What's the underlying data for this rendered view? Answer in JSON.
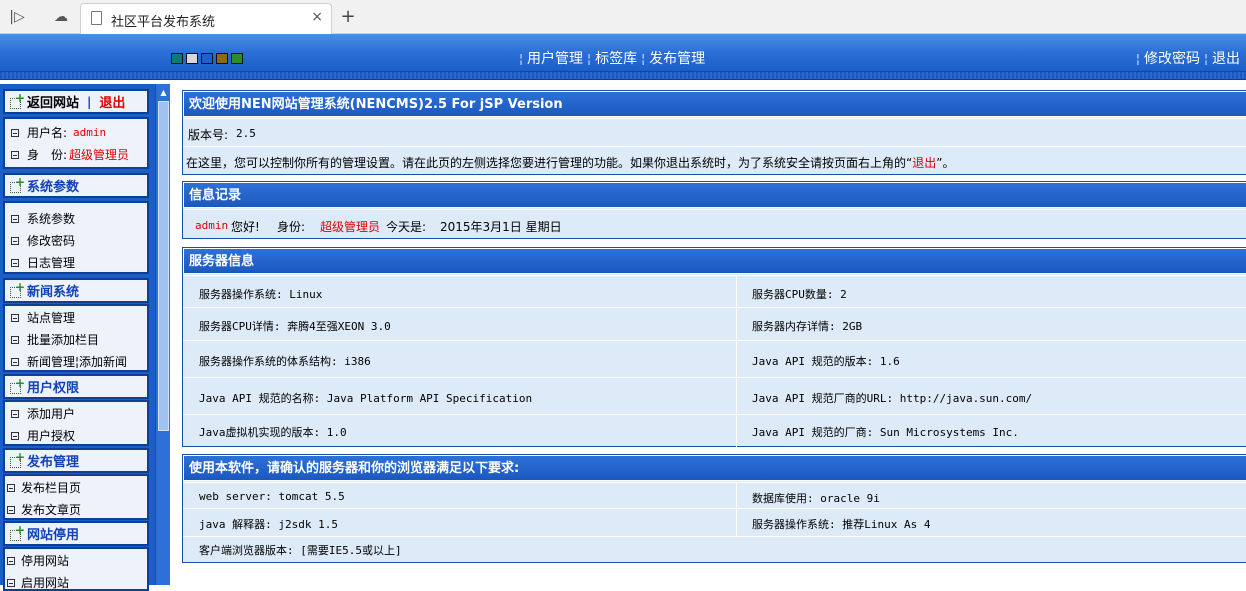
{
  "browser": {
    "tab_title": "社区平台发布系统",
    "tab_close": "×",
    "new_tab": "+",
    "back_icon": "|▷",
    "cloud_icon": "☁"
  },
  "topbar": {
    "swatch_colors": [
      "#0a7a7a",
      "#d8d8d8",
      "#1f5fd2",
      "#8c6a14",
      "#2a8f2a"
    ],
    "nav": [
      "用户管理",
      "标签库",
      "发布管理"
    ],
    "links": [
      "修改密码",
      "退出"
    ],
    "sep": "¦"
  },
  "sidebar": {
    "header": {
      "back": "返回网站",
      "divider": "|",
      "logout": "退出"
    },
    "user": {
      "username_label": "用户名:",
      "username": "admin",
      "role_label": "身　份:",
      "role": "超级管理员"
    },
    "sections": [
      {
        "title": "系统参数",
        "items": [
          "系统参数",
          "修改密码",
          "日志管理"
        ]
      },
      {
        "title": "新闻系统",
        "items": [
          "站点管理",
          "批量添加栏目",
          "新闻管理¦添加新闻"
        ]
      },
      {
        "title": "用户权限",
        "items": [
          "添加用户",
          "用户授权"
        ]
      },
      {
        "title": "发布管理",
        "items": [
          "发布栏目页",
          "发布文章页"
        ]
      },
      {
        "title": "网站停用",
        "items": [
          "停用网站",
          "启用网站"
        ]
      }
    ]
  },
  "welcome": {
    "title": "欢迎使用NEN网站管理系统(NENCMS)2.5 For jSP Version",
    "version_label": "版本号:",
    "version": "2.5",
    "desc_before": "在这里，您可以控制你所有的管理设置。请在此页的左侧选择您要进行管理的功能。如果你退出系统时，为了系统安全请按页面右上角的“",
    "desc_link": "退出",
    "desc_after": "”。"
  },
  "info": {
    "title": "信息记录",
    "user": "admin",
    "greet": "您好!",
    "role_label": "身份:",
    "role": "超级管理员",
    "today_label": "今天是:",
    "date": "2015年3月1日 星期日"
  },
  "server": {
    "title": "服务器信息",
    "rows": [
      [
        "服务器操作系统: Linux",
        "服务器CPU数量: 2"
      ],
      [
        "服务器CPU详情: 奔腾4至强XEON 3.0",
        "服务器内存详情: 2GB"
      ],
      [
        "服务器操作系统的体系结构:  i386",
        "Java API 规范的版本: 1.6"
      ],
      [
        "Java API 规范的名称: Java Platform API Specification",
        "Java API 规范厂商的URL: http://java.sun.com/"
      ],
      [
        "Java虚拟机实现的版本: 1.0",
        "Java API 规范的厂商: Sun Microsystems Inc."
      ]
    ]
  },
  "requirements": {
    "title": "使用本软件，请确认的服务器和你的浏览器满足以下要求:",
    "rows": [
      [
        "web server:  tomcat 5.5",
        "数据库使用:  oracle 9i"
      ],
      [
        "java 解释器: j2sdk 1.5",
        "服务器操作系统: 推荐Linux As 4"
      ],
      [
        "客户端浏览器版本: [需要IE5.5或以上]",
        ""
      ]
    ]
  }
}
